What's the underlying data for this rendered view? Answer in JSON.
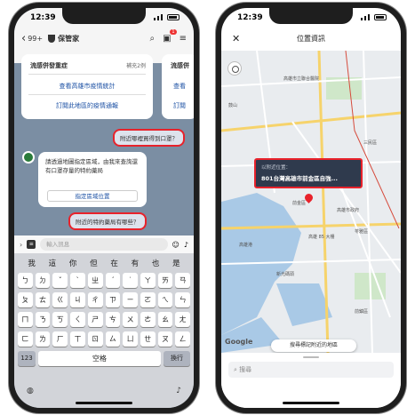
{
  "left_phone": {
    "time": "12:39",
    "back_count": "99+",
    "title": "保管家",
    "badge": "1",
    "card1": {
      "title": "流感併發重症",
      "more": "補充2例",
      "link1": "查看高雄市疫情統計",
      "link2": "訂閱此地區的疫情通報"
    },
    "card2": {
      "title": "流感併",
      "link1": "查看",
      "link2": "訂閱"
    },
    "user_msg1": "附近哪裡買得到口罩？",
    "bot_msg": "請透過地圖指定區域，由我來查詢還有口罩存量的特約藥局",
    "bot_button": "指定區域位置",
    "user_msg2": "附近的特約藥局有哪些？",
    "input_placeholder": "輸入訊息",
    "suggestions": [
      "我",
      "這",
      "你",
      "但",
      "在",
      "有",
      "也",
      "是"
    ],
    "kb_row1": [
      "ㄅ",
      "ㄉ",
      "ˇ",
      "ˋ",
      "ㄓ",
      "ˊ",
      "˙",
      "ㄚ",
      "ㄞ",
      "ㄢ"
    ],
    "kb_row2": [
      "ㄆ",
      "ㄊ",
      "ㄍ",
      "ㄐ",
      "ㄔ",
      "ㄗ",
      "ㄧ",
      "ㄛ",
      "ㄟ",
      "ㄣ"
    ],
    "kb_row3": [
      "ㄇ",
      "ㄋ",
      "ㄎ",
      "ㄑ",
      "ㄕ",
      "ㄘ",
      "ㄨ",
      "ㄜ",
      "ㄠ",
      "ㄤ"
    ],
    "kb_row4": [
      "ㄈ",
      "ㄌ",
      "ㄏ",
      "ㄒ",
      "ㄖ",
      "ㄙ",
      "ㄩ",
      "ㄝ",
      "ㄡ",
      "ㄥ"
    ],
    "key_numbers": "123",
    "key_space": "空格",
    "key_return": "換行"
  },
  "right_phone": {
    "time": "12:39",
    "title": "位置資訊",
    "address_label": "以附近位置：",
    "address": "801台灣高雄市前金區自強...",
    "search_area_button": "搜尋標記附近的地區",
    "search_placeholder": "搜尋",
    "google_logo": "Google",
    "labels": [
      "高雄市立聯合醫院",
      "鼓山",
      "高雄港",
      "前鎮區",
      "苓雅區",
      "高雄市政府",
      "新光碼頭",
      "三民區",
      "前金區",
      "高雄 85 大樓"
    ]
  },
  "colors": {
    "highlight": "#e8222b",
    "link": "#1a4fa3",
    "chat_bg": "#7b8ea3"
  }
}
